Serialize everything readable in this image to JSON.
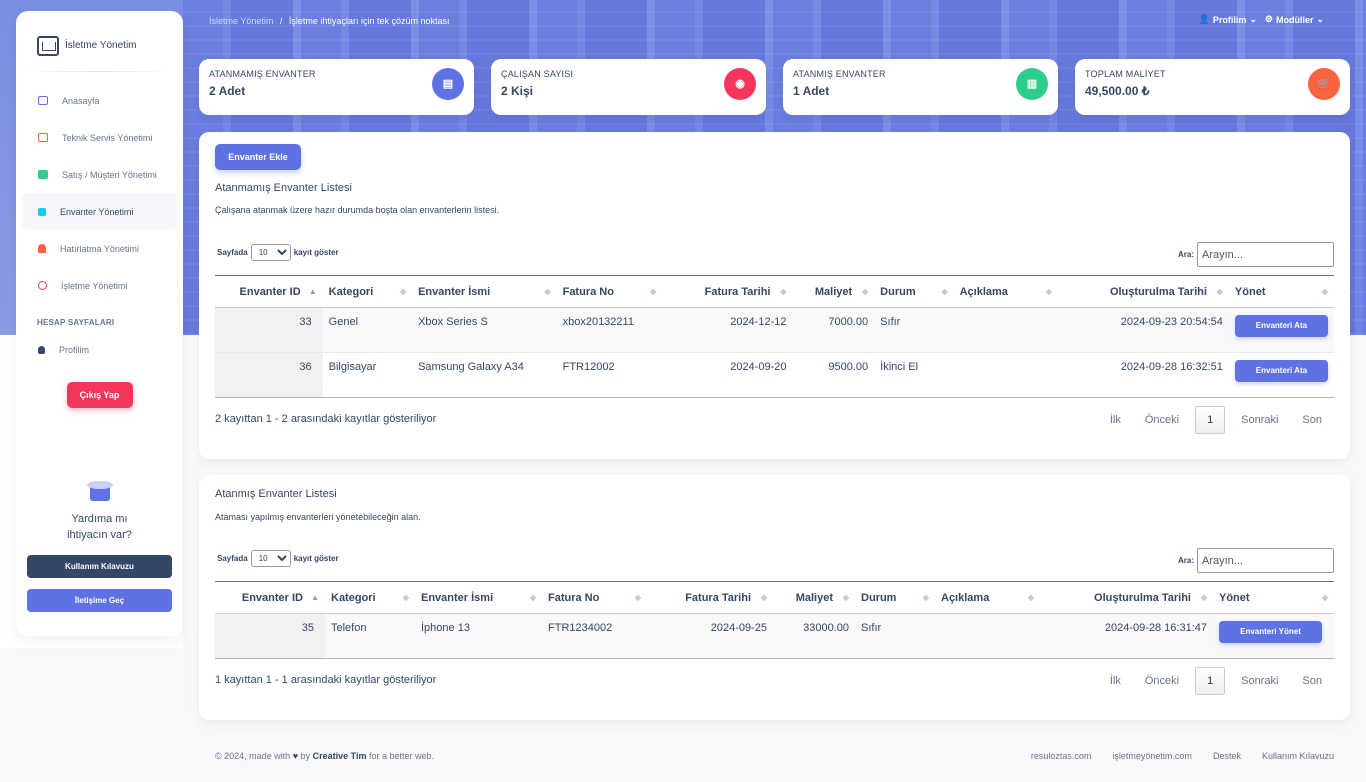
{
  "sidebar": {
    "brand": "İsletme Yönetim",
    "items": [
      {
        "label": "Anasayfa",
        "color": "#5e72e4"
      },
      {
        "label": "Teknik Servis Yönetimi",
        "color": "#fb6340"
      },
      {
        "label": "Satış / Müşteri Yönetimi",
        "color": "#2dce89"
      },
      {
        "label": "Envanter Yönetimi",
        "color": "#11cdef"
      },
      {
        "label": "Hatırlatma Yönetimi",
        "color": "#f5365c"
      },
      {
        "label": "İşletme Yönetimi",
        "color": "#f5365c"
      }
    ],
    "section_head": "HESAP SAYFALARI",
    "profile": "Profilim",
    "logout": "Çıkış Yap",
    "help_title": "Yardıma mı ihtiyacın var?",
    "guide_btn": "Kullanım Kılavuzu",
    "contact_btn": "İletişime Geç"
  },
  "topbar": {
    "crumb_root": "İsletme Yönetim",
    "crumb_sep": "/",
    "crumb_current": "İşletme ihtiyaçları için tek çözüm noktası",
    "profile": "Profilim",
    "modules": "Modüller"
  },
  "stats": [
    {
      "label": "ATANMAMIŞ ENVANTER",
      "value": "2 Adet",
      "color": "#5e72e4"
    },
    {
      "label": "ÇALIŞAN SAYISI",
      "value": "2 Kişi",
      "color": "#f5365c"
    },
    {
      "label": "ATANMIŞ ENVANTER",
      "value": "1 Adet",
      "color": "#2dce89"
    },
    {
      "label": "TOPLAM MALİYET",
      "value": "49,500.00 ₺",
      "color": "#fb6340"
    }
  ],
  "unassigned": {
    "add_btn": "Envanter Ekle",
    "title": "Atanmamış Envanter Listesi",
    "subtitle": "Çalışana atanmak üzere hazır durumda boşta olan envanterlerin listesi.",
    "len_prefix": "Sayfada",
    "len_value": "10",
    "len_suffix": "kayıt göster",
    "search_label": "Ara:",
    "search_placeholder": "Arayın...",
    "headers": [
      "Envanter ID",
      "Kategori",
      "Envanter İsmi",
      "Fatura No",
      "Fatura Tarihi",
      "Maliyet",
      "Durum",
      "Açıklama",
      "Oluşturulma Tarihi",
      "Yönet"
    ],
    "rows": [
      {
        "id": "33",
        "kategori": "Genel",
        "isim": "Xbox Series S",
        "fatura_no": "xbox20132211",
        "fatura_tarihi": "2024-12-12",
        "maliyet": "7000.00",
        "durum": "Sıfır",
        "aciklama": "",
        "olusturma": "2024-09-23 20:54:54",
        "action": "Envanteri Ata"
      },
      {
        "id": "36",
        "kategori": "Bilgisayar",
        "isim": "Samsung Galaxy A34",
        "fatura_no": "FTR12002",
        "fatura_tarihi": "2024-09-20",
        "maliyet": "9500.00",
        "durum": "İkinci El",
        "aciklama": "",
        "olusturma": "2024-09-28 16:32:51",
        "action": "Envanteri Ata"
      }
    ],
    "info": "2 kayıttan 1 - 2 arasındaki kayıtlar gösteriliyor",
    "pager": {
      "first": "İlk",
      "prev": "Önceki",
      "current": "1",
      "next": "Sonraki",
      "last": "Son"
    }
  },
  "assigned": {
    "title": "Atanmış Envanter Listesi",
    "subtitle": "Ataması yapılmış envanterleri yönetebileceğin alan.",
    "len_prefix": "Sayfada",
    "len_value": "10",
    "len_suffix": "kayıt göster",
    "search_label": "Ara:",
    "search_placeholder": "Arayın...",
    "headers": [
      "Envanter ID",
      "Kategori",
      "Envanter İsmi",
      "Fatura No",
      "Fatura Tarihi",
      "Maliyet",
      "Durum",
      "Açıklama",
      "Oluşturulma Tarihi",
      "Yönet"
    ],
    "rows": [
      {
        "id": "35",
        "kategori": "Telefon",
        "isim": "İphone 13",
        "fatura_no": "FTR1234002",
        "fatura_tarihi": "2024-09-25",
        "maliyet": "33000.00",
        "durum": "Sıfır",
        "aciklama": "",
        "olusturma": "2024-09-28 16:31:47",
        "action": "Envanteri Yönet"
      }
    ],
    "info": "1 kayıttan 1 - 1 arasındaki kayıtlar gösteriliyor",
    "pager": {
      "first": "İlk",
      "prev": "Önceki",
      "current": "1",
      "next": "Sonraki",
      "last": "Son"
    }
  },
  "footer": {
    "prefix": "© 2024, made with",
    "by": "by",
    "author": "Creative Tim",
    "suffix": "for a better web.",
    "links": [
      "resuloztas.com",
      "işletmeyönetim.com",
      "Destek",
      "Kullanım Kılavuzu"
    ]
  }
}
